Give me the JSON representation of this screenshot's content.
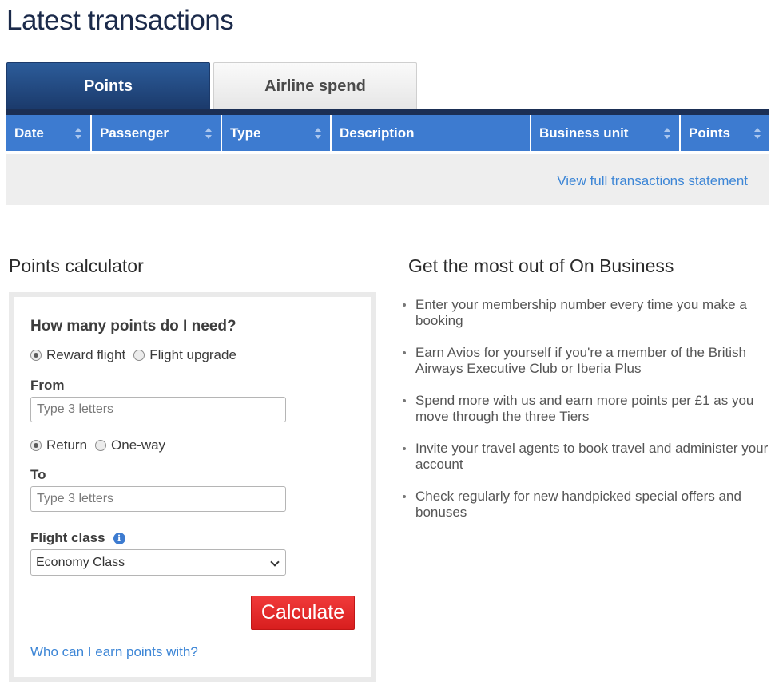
{
  "page": {
    "title": "Latest transactions"
  },
  "tabs": [
    {
      "label": "Points",
      "active": true
    },
    {
      "label": "Airline spend",
      "active": false
    }
  ],
  "table": {
    "columns": [
      "Date",
      "Passenger",
      "Type",
      "Description",
      "Business unit",
      "Points"
    ],
    "sortable": [
      true,
      true,
      true,
      false,
      true,
      true
    ],
    "rows": [],
    "footer_link": "View full transactions statement"
  },
  "calculator": {
    "title": "Points calculator",
    "question": "How many points do I need?",
    "trip_kind_options": [
      "Reward flight",
      "Flight upgrade"
    ],
    "trip_kind_selected": "Reward flight",
    "from_label": "From",
    "from_placeholder": "Type 3 letters",
    "journey_options": [
      "Return",
      "One-way"
    ],
    "journey_selected": "Return",
    "to_label": "To",
    "to_placeholder": "Type 3 letters",
    "class_label": "Flight class",
    "class_info_icon": "i",
    "class_selected": "Economy Class",
    "calculate_label": "Calculate",
    "earn_link": "Who can I earn points with?"
  },
  "benefits": {
    "title": "Get the most out of On Business",
    "items": [
      "Enter your membership number every time you make a booking",
      "Earn Avios for yourself if you're a member of the British Airways Executive Club or Iberia Plus",
      "Spend more with us and earn more points per £1 as you move through the three Tiers",
      "Invite your travel agents to book travel and administer your account",
      "Check regularly for new handpicked special offers and bonuses"
    ]
  },
  "colors": {
    "tab_active": "#1b3a6b",
    "table_header": "#3d7bd0",
    "link": "#3d86d6",
    "calculate_button": "#e02626"
  }
}
